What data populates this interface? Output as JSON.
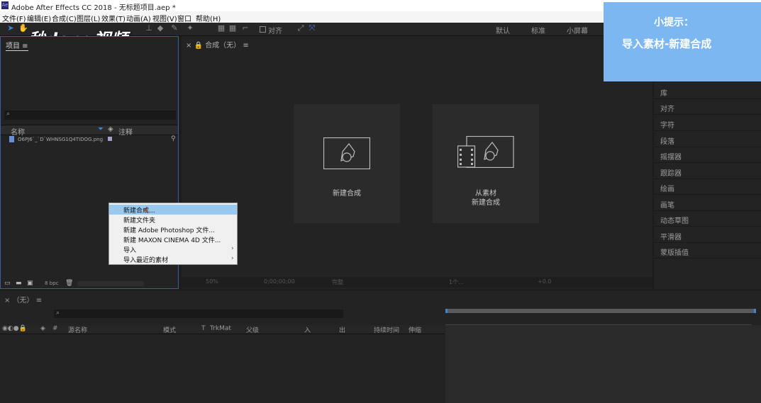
{
  "titlebar": {
    "title": "Adobe After Effects CC 2018 - 无标题项目.aep *"
  },
  "menu": [
    "文件(F)",
    "编辑(E)",
    "合成(C)",
    "图层(L)",
    "效果(T)",
    "动画(A)",
    "视图(V)",
    "窗口",
    "帮助(H)"
  ],
  "toolbar": {
    "align_label": "对齐",
    "workspaces": [
      "默认",
      "标准",
      "小屏幕"
    ]
  },
  "watermark": "秒dong视频",
  "project": {
    "tab_label": "项目",
    "columns": {
      "name": "名称",
      "comment": "注释"
    },
    "items": [
      {
        "name": "O6PJ6`_`D`WHNSG1Q4TIDOG.png"
      }
    ],
    "footer_bpc": "8 bpc"
  },
  "composition": {
    "tab_label": "合成（无）",
    "new_comp_label": "新建合成",
    "from_footage_line1": "从素材",
    "from_footage_line2": "新建合成",
    "footer": {
      "zoom": "50%",
      "time": "0;00;00;00",
      "view": "完整",
      "cameras": "1个...",
      "exposure": "+0.0"
    }
  },
  "right_panel": [
    "库",
    "对齐",
    "字符",
    "段落",
    "摇摆器",
    "跟踪器",
    "绘画",
    "画笔",
    "动态草图",
    "平滑器",
    "蒙版插值"
  ],
  "hint": {
    "title": "小提示：",
    "text": "导入素材-新建合成"
  },
  "context_menu": [
    {
      "label": "新建合成...",
      "highlighted": true,
      "submenu": false
    },
    {
      "label": "新建文件夹",
      "highlighted": false,
      "submenu": false
    },
    {
      "label": "新建 Adobe Photoshop 文件...",
      "highlighted": false,
      "submenu": false
    },
    {
      "label": "新建 MAXON CINEMA 4D 文件...",
      "highlighted": false,
      "submenu": false
    },
    {
      "label": "导入",
      "highlighted": false,
      "submenu": true
    },
    {
      "label": "导入最近的素材",
      "highlighted": false,
      "submenu": true
    }
  ],
  "timeline": {
    "tab_label": "（无）",
    "columns": {
      "source_name": "源名称",
      "mode": "模式",
      "t": "T",
      "trkmat": "TrkMat",
      "parent": "父级",
      "in": "入",
      "out": "出",
      "duration": "持续时间",
      "stretch": "伸缩"
    }
  },
  "colors": {
    "accent": "#3a87d6",
    "hint_bg": "#7cb7f2",
    "menu_highlight": "#99c9ef"
  }
}
